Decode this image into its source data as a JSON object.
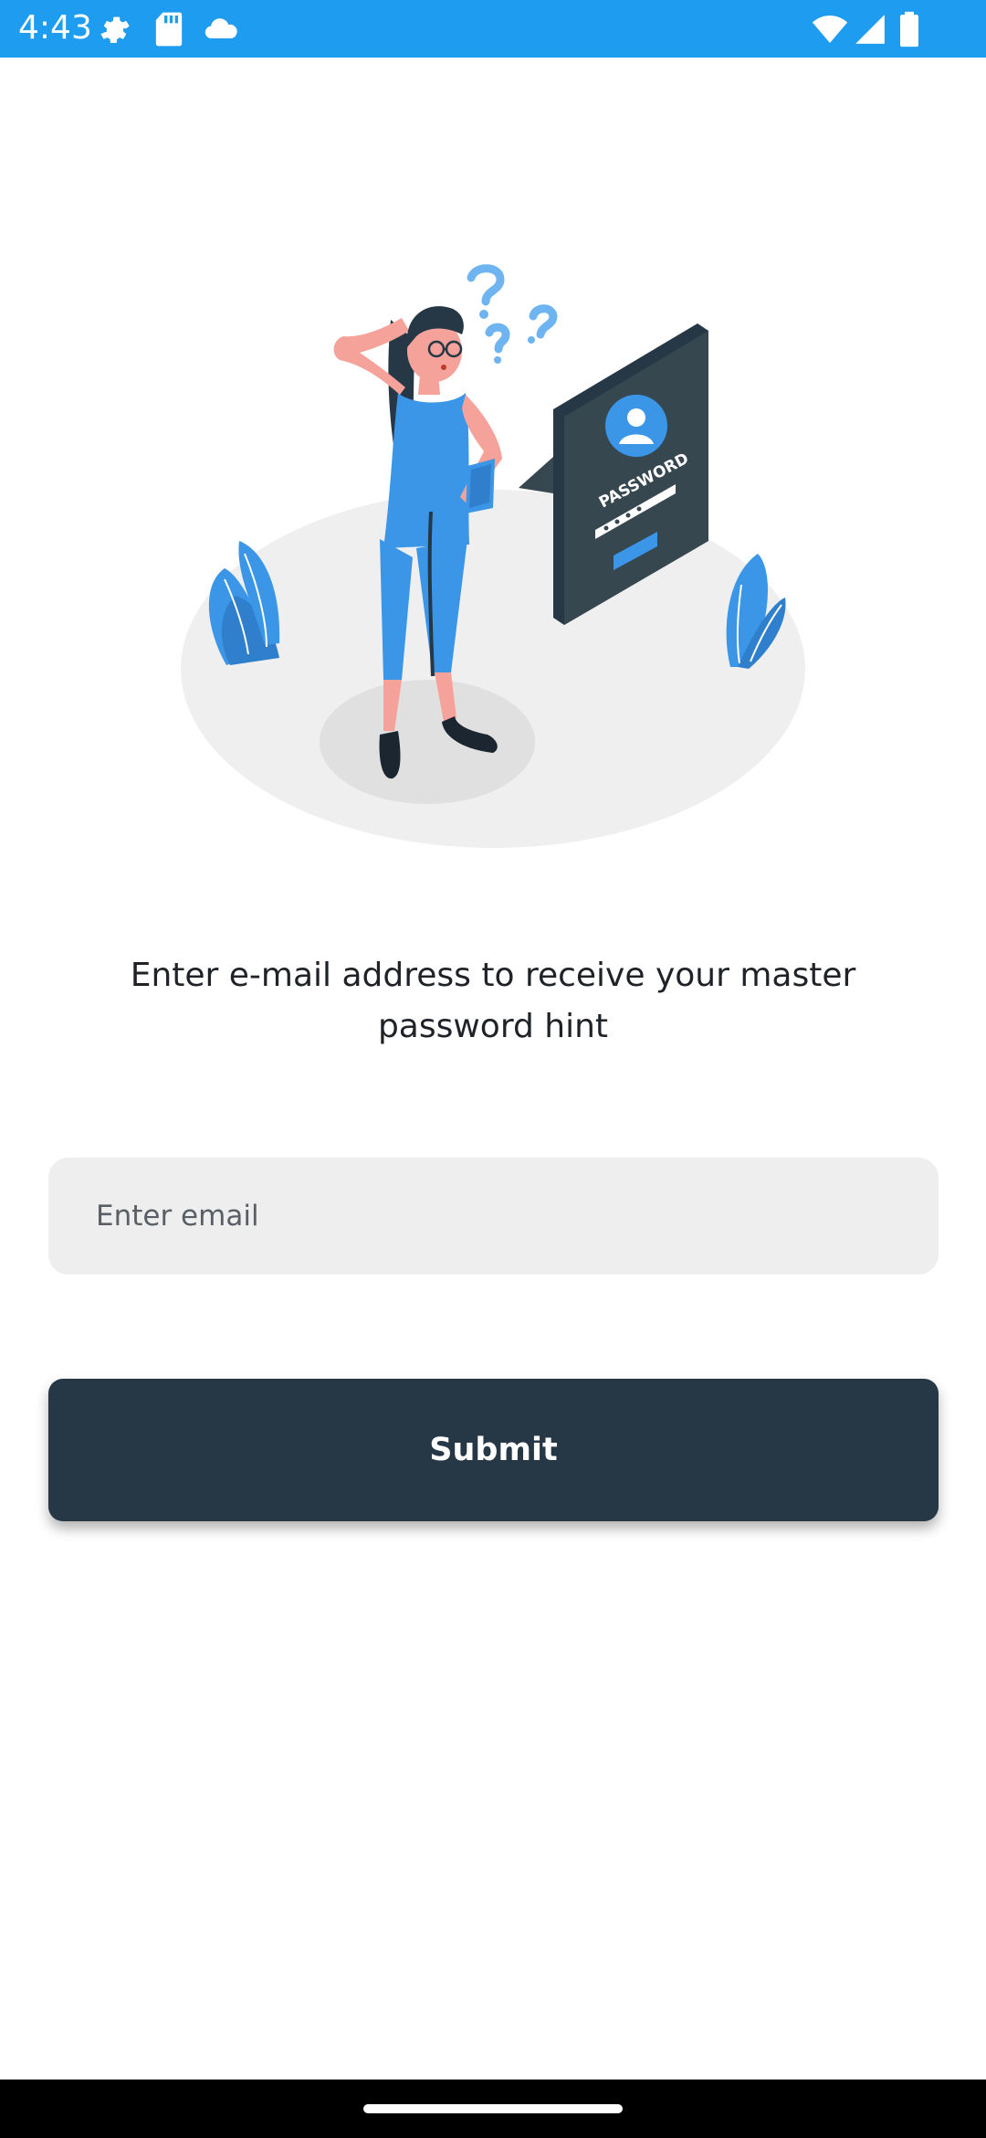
{
  "status_bar": {
    "time": "4:43",
    "icons": [
      "settings-icon",
      "sd-card-icon",
      "cloud-icon",
      "wifi-icon",
      "signal-icon",
      "battery-icon"
    ],
    "background_color": "#1e9cf0"
  },
  "illustration": {
    "name": "forgot-password-illustration",
    "screen_label": "PASSWORD",
    "accent_color": "#3b96e8",
    "dark_color": "#37474f"
  },
  "main": {
    "prompt": "Enter e-mail address to receive your master password hint",
    "email_field": {
      "placeholder": "Enter email",
      "value": ""
    },
    "submit_label": "Submit",
    "submit_color": "#263746"
  },
  "nav_bar": {
    "background_color": "#000000"
  }
}
